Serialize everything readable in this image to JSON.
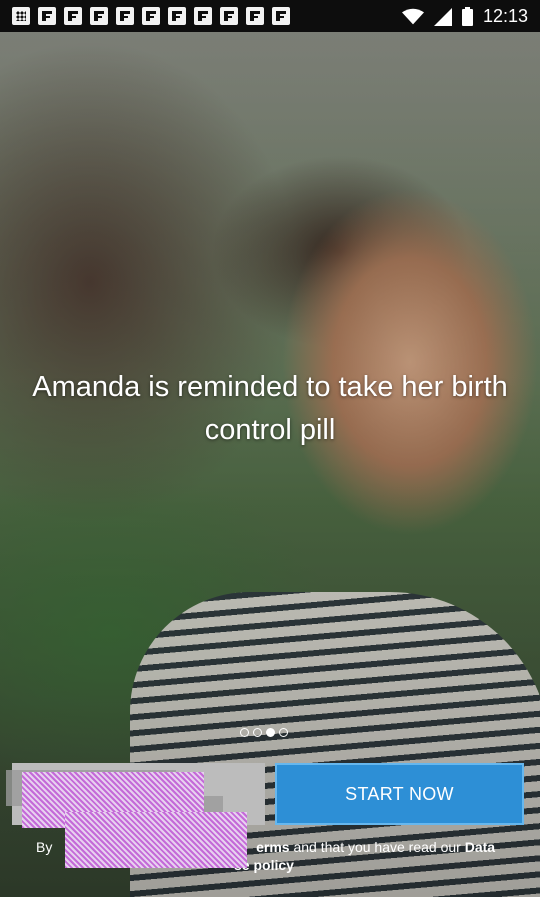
{
  "status_bar": {
    "time": "12:13",
    "notification_icons": [
      "keyboard-icon",
      "flipboard-icon",
      "flipboard-icon",
      "flipboard-icon",
      "flipboard-icon",
      "flipboard-icon",
      "flipboard-icon",
      "flipboard-icon",
      "flipboard-icon",
      "flipboard-icon",
      "flipboard-icon"
    ],
    "system_icons": [
      "wifi-icon",
      "signal-icon",
      "battery-icon"
    ]
  },
  "onboarding": {
    "headline": "Amanda is reminded to take her birth control pill",
    "pager": {
      "total": 4,
      "active_index": 2
    },
    "start_button_label": "START NOW",
    "legal": {
      "prefix": "By",
      "terms_link": "erms",
      "middle": " and that you have read our ",
      "data_link": "Data",
      "policy_link": "se policy"
    }
  }
}
